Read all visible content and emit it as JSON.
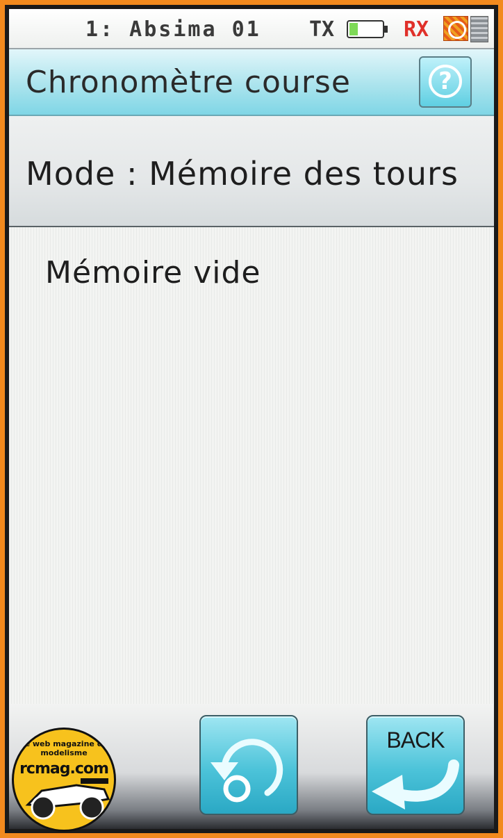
{
  "status_bar": {
    "model": "1: Absima 01",
    "tx_label": "TX",
    "rx_label": "RX",
    "battery_level": 0.25,
    "icons": [
      "battery-icon",
      "no-signal-icon",
      "calculator-icon"
    ],
    "colors": {
      "rx": "#e0302a",
      "battery": "#7ed957"
    }
  },
  "header": {
    "title": "Chronomètre course",
    "help_icon": "?"
  },
  "mode": {
    "label": "Mode : Mémoire des tours"
  },
  "content": {
    "empty_message": "Mémoire vide"
  },
  "buttons": {
    "reset_icon": "reset-icon",
    "back_label": "BACK"
  },
  "watermark": {
    "tagline": "Le web magazine du modelisme",
    "site": "rcmag.com"
  },
  "colors": {
    "title_bar": "#a6e2ec",
    "button": "#4cc3d9",
    "frame": "#f28a1e"
  }
}
